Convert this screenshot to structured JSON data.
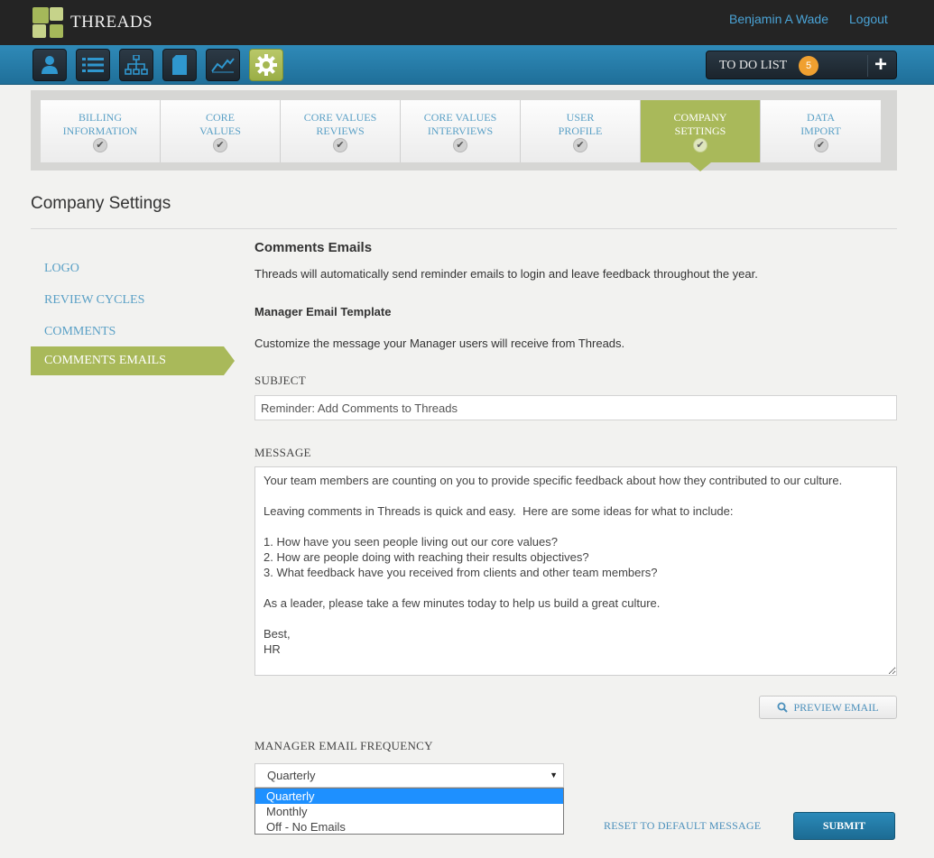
{
  "app": {
    "name": "THREADS",
    "user_name": "Benjamin A Wade",
    "logout_label": "Logout"
  },
  "nav_icons": [
    {
      "name": "user-icon",
      "active": false
    },
    {
      "name": "list-icon",
      "active": false
    },
    {
      "name": "org-chart-icon",
      "active": false
    },
    {
      "name": "document-icon",
      "active": false
    },
    {
      "name": "chart-icon",
      "active": false
    },
    {
      "name": "gear-icon",
      "active": true
    }
  ],
  "todo": {
    "label": "TO DO LIST",
    "count": "5",
    "add_label": "+"
  },
  "tabs": [
    {
      "label": "BILLING\nINFORMATION",
      "active": false
    },
    {
      "label": "CORE\nVALUES",
      "active": false
    },
    {
      "label": "CORE VALUES\nREVIEWS",
      "active": false
    },
    {
      "label": "CORE VALUES\nINTERVIEWS",
      "active": false
    },
    {
      "label": "USER\nPROFILE",
      "active": false
    },
    {
      "label": "COMPANY\nSETTINGS",
      "active": true
    },
    {
      "label": "DATA\nIMPORT",
      "active": false
    }
  ],
  "page": {
    "title": "Company Settings"
  },
  "sidebar": {
    "items": [
      {
        "label": "LOGO",
        "active": false
      },
      {
        "label": "REVIEW CYCLES",
        "active": false
      },
      {
        "label": "COMMENTS",
        "active": false
      },
      {
        "label": "COMMENTS EMAILS",
        "active": true
      }
    ]
  },
  "main": {
    "heading": "Comments Emails",
    "description": "Threads will automatically send reminder emails to login and leave feedback throughout the year.",
    "template_heading": "Manager Email Template",
    "template_description": "Customize the message your Manager users will receive from Threads.",
    "subject_label": "SUBJECT",
    "subject_value": "Reminder: Add Comments to Threads",
    "message_label": "MESSAGE",
    "message_value": "Your team members are counting on you to provide specific feedback about how they contributed to our culture.\n\nLeaving comments in Threads is quick and easy.  Here are some ideas for what to include:\n\n1. How have you seen people living out our core values?\n2. How are people doing with reaching their results objectives?\n3. What feedback have you received from clients and other team members?\n\nAs a leader, please take a few minutes today to help us build a great culture.\n\nBest,\nHR",
    "preview_label": "PREVIEW EMAIL",
    "frequency_label": "MANAGER EMAIL FREQUENCY",
    "frequency_selected": "Quarterly",
    "frequency_options": [
      "Quarterly",
      "Monthly",
      "Off - No Emails"
    ],
    "reset_label": "RESET TO DEFAULT MESSAGE",
    "submit_label": "SUBMIT"
  },
  "colors": {
    "accent_green": "#a9b95a",
    "nav_blue": "#2f8ab8",
    "link_blue": "#5aa0c6",
    "badge_orange": "#f0a030"
  }
}
